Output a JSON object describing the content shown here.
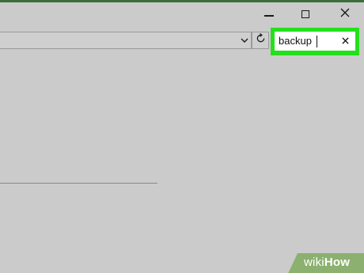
{
  "window": {
    "minimize_icon": "minimize-icon",
    "maximize_icon": "maximize-icon",
    "close_icon": "close-icon"
  },
  "address_bar": {
    "dropdown_icon": "chevron-down-icon",
    "refresh_icon": "refresh-icon"
  },
  "search": {
    "value": "backup",
    "clear_icon": "close-icon",
    "highlight_color": "#24e01c"
  },
  "watermark": {
    "logo_part1": "wiki",
    "logo_part2": "How",
    "color": "#8bb06f"
  }
}
